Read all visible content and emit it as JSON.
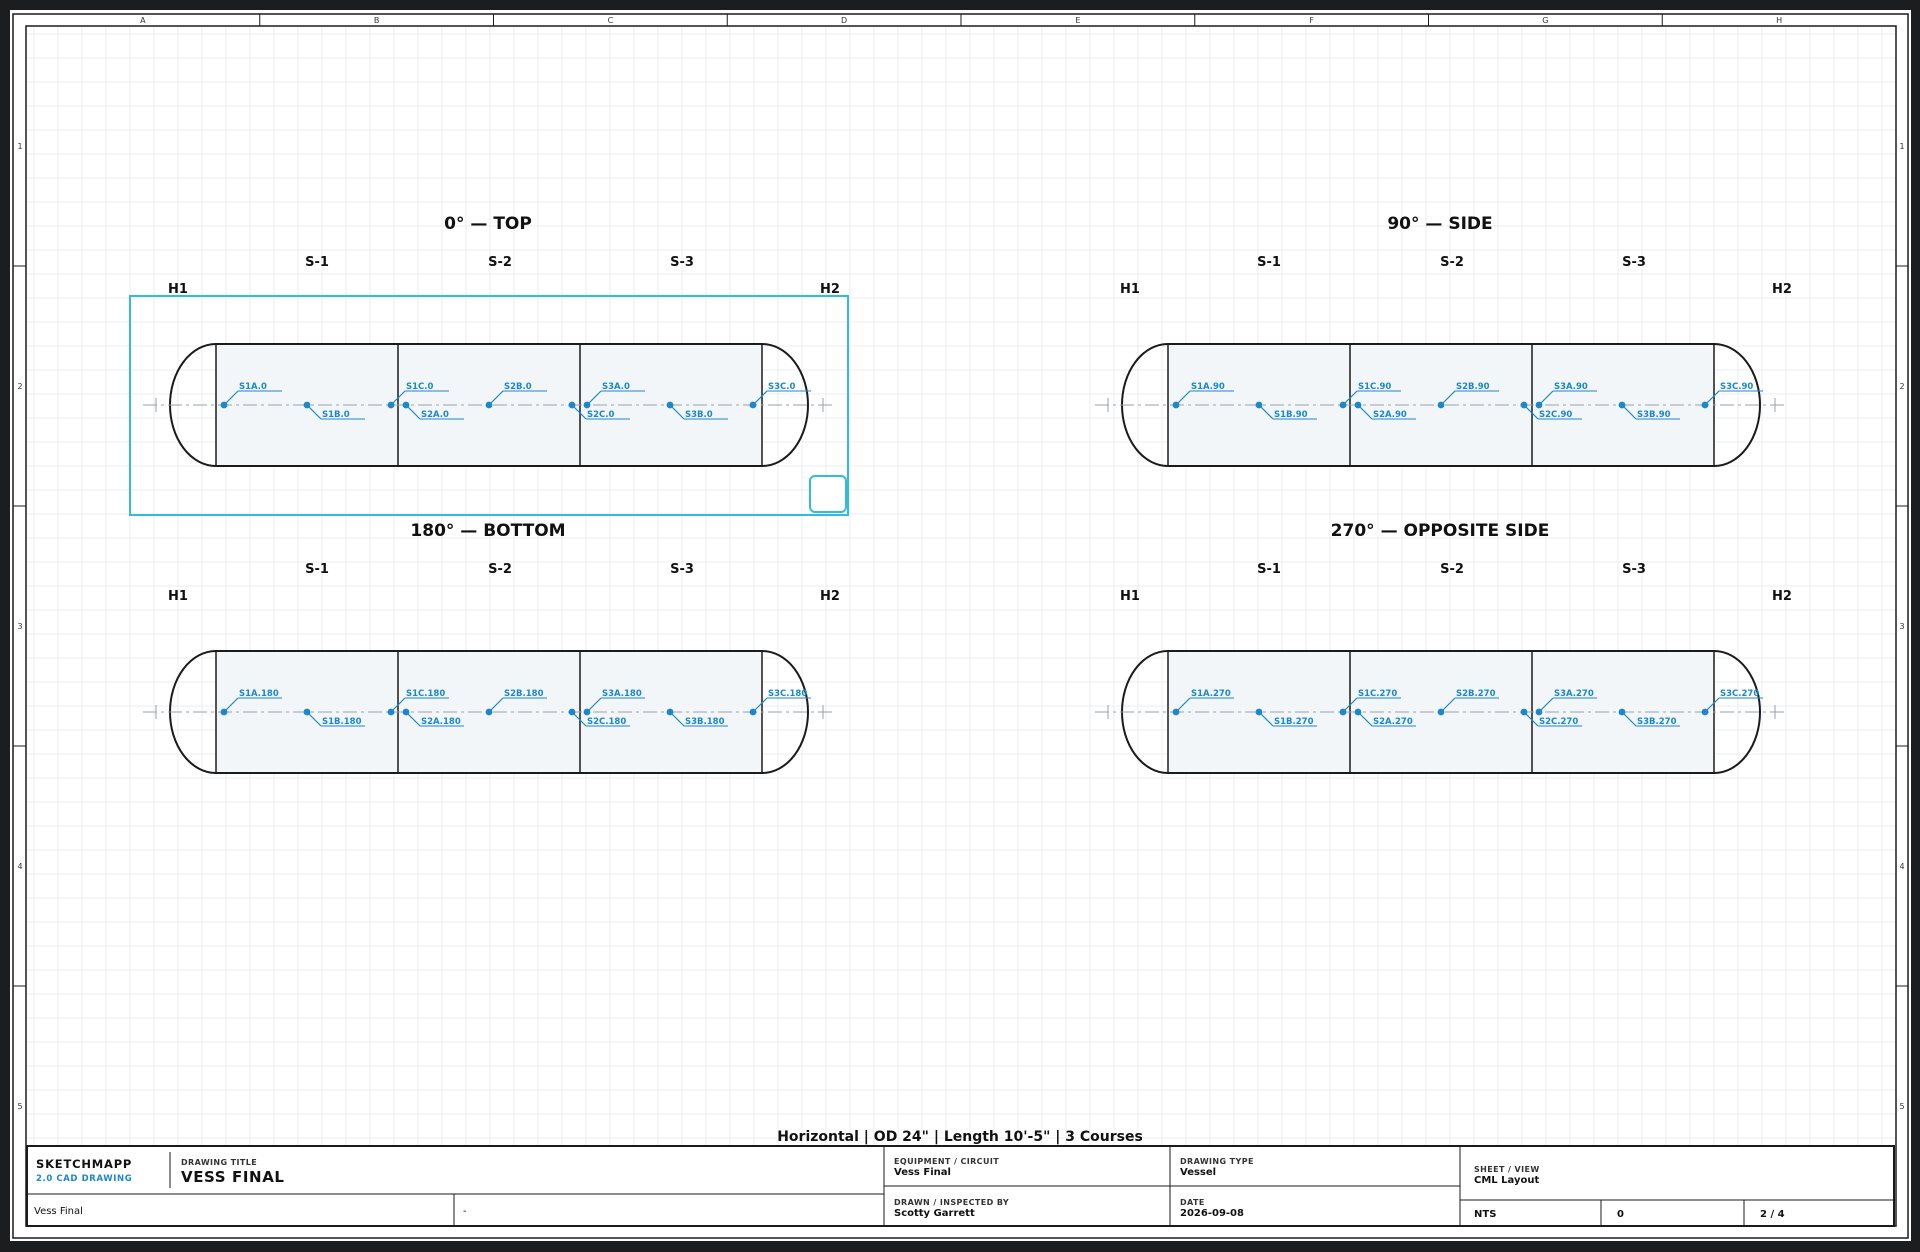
{
  "grid": {
    "columns": [
      "A",
      "B",
      "C",
      "D",
      "E",
      "F",
      "G",
      "H"
    ],
    "rows": [
      "1",
      "2",
      "3",
      "4",
      "5"
    ]
  },
  "views": [
    {
      "title": "0° — TOP",
      "h1": "H1",
      "h2": "H2",
      "shells": [
        "S-1",
        "S-2",
        "S-3"
      ],
      "points": [
        "S1A.0",
        "S1B.0",
        "S1C.0",
        "S2A.0",
        "S2B.0",
        "S2C.0",
        "S3A.0",
        "S3B.0",
        "S3C.0"
      ]
    },
    {
      "title": "90° — SIDE",
      "h1": "H1",
      "h2": "H2",
      "shells": [
        "S-1",
        "S-2",
        "S-3"
      ],
      "points": [
        "S1A.90",
        "S1B.90",
        "S1C.90",
        "S2A.90",
        "S2B.90",
        "S2C.90",
        "S3A.90",
        "S3B.90",
        "S3C.90"
      ]
    },
    {
      "title": "180° — BOTTOM",
      "h1": "H1",
      "h2": "H2",
      "shells": [
        "S-1",
        "S-2",
        "S-3"
      ],
      "points": [
        "S1A.180",
        "S1B.180",
        "S1C.180",
        "S2A.180",
        "S2B.180",
        "S2C.180",
        "S3A.180",
        "S3B.180",
        "S3C.180"
      ]
    },
    {
      "title": "270° — OPPOSITE SIDE",
      "h1": "H1",
      "h2": "H2",
      "shells": [
        "S-1",
        "S-2",
        "S-3"
      ],
      "points": [
        "S1A.270",
        "S1B.270",
        "S1C.270",
        "S2A.270",
        "S2B.270",
        "S2C.270",
        "S3A.270",
        "S3B.270",
        "S3C.270"
      ]
    }
  ],
  "selected_view": 0,
  "summary": "Horizontal | OD 24\" | Length 10'-5\" | 3 Courses",
  "title_block": {
    "brand": "SKETCHMAPP",
    "brand_sub": "2.0 CAD DRAWING",
    "drawing_title_label": "DRAWING TITLE",
    "drawing_title": "VESS FINAL",
    "equipment_label": "EQUIPMENT / CIRCUIT",
    "equipment": "Vess Final",
    "drawing_type_label": "DRAWING TYPE",
    "drawing_type": "Vessel",
    "sheet_view_label": "SHEET / VIEW",
    "sheet_view": "CML Layout",
    "footer_left": "Vess Final",
    "footer_mid": "-",
    "drawn_label": "DRAWN / INSPECTED BY",
    "drawn_by": "Scotty Garrett",
    "date_label": "DATE",
    "date": "2026-09-08",
    "scale": "NTS",
    "revision": "0",
    "sheet_number": "2 / 4"
  },
  "colors": {
    "point": "#1a88c9",
    "selection": "#33bcd9",
    "outline": "#1b1b1b",
    "shell_fill": "#f3f6f9",
    "grid": "#e9edf1"
  }
}
